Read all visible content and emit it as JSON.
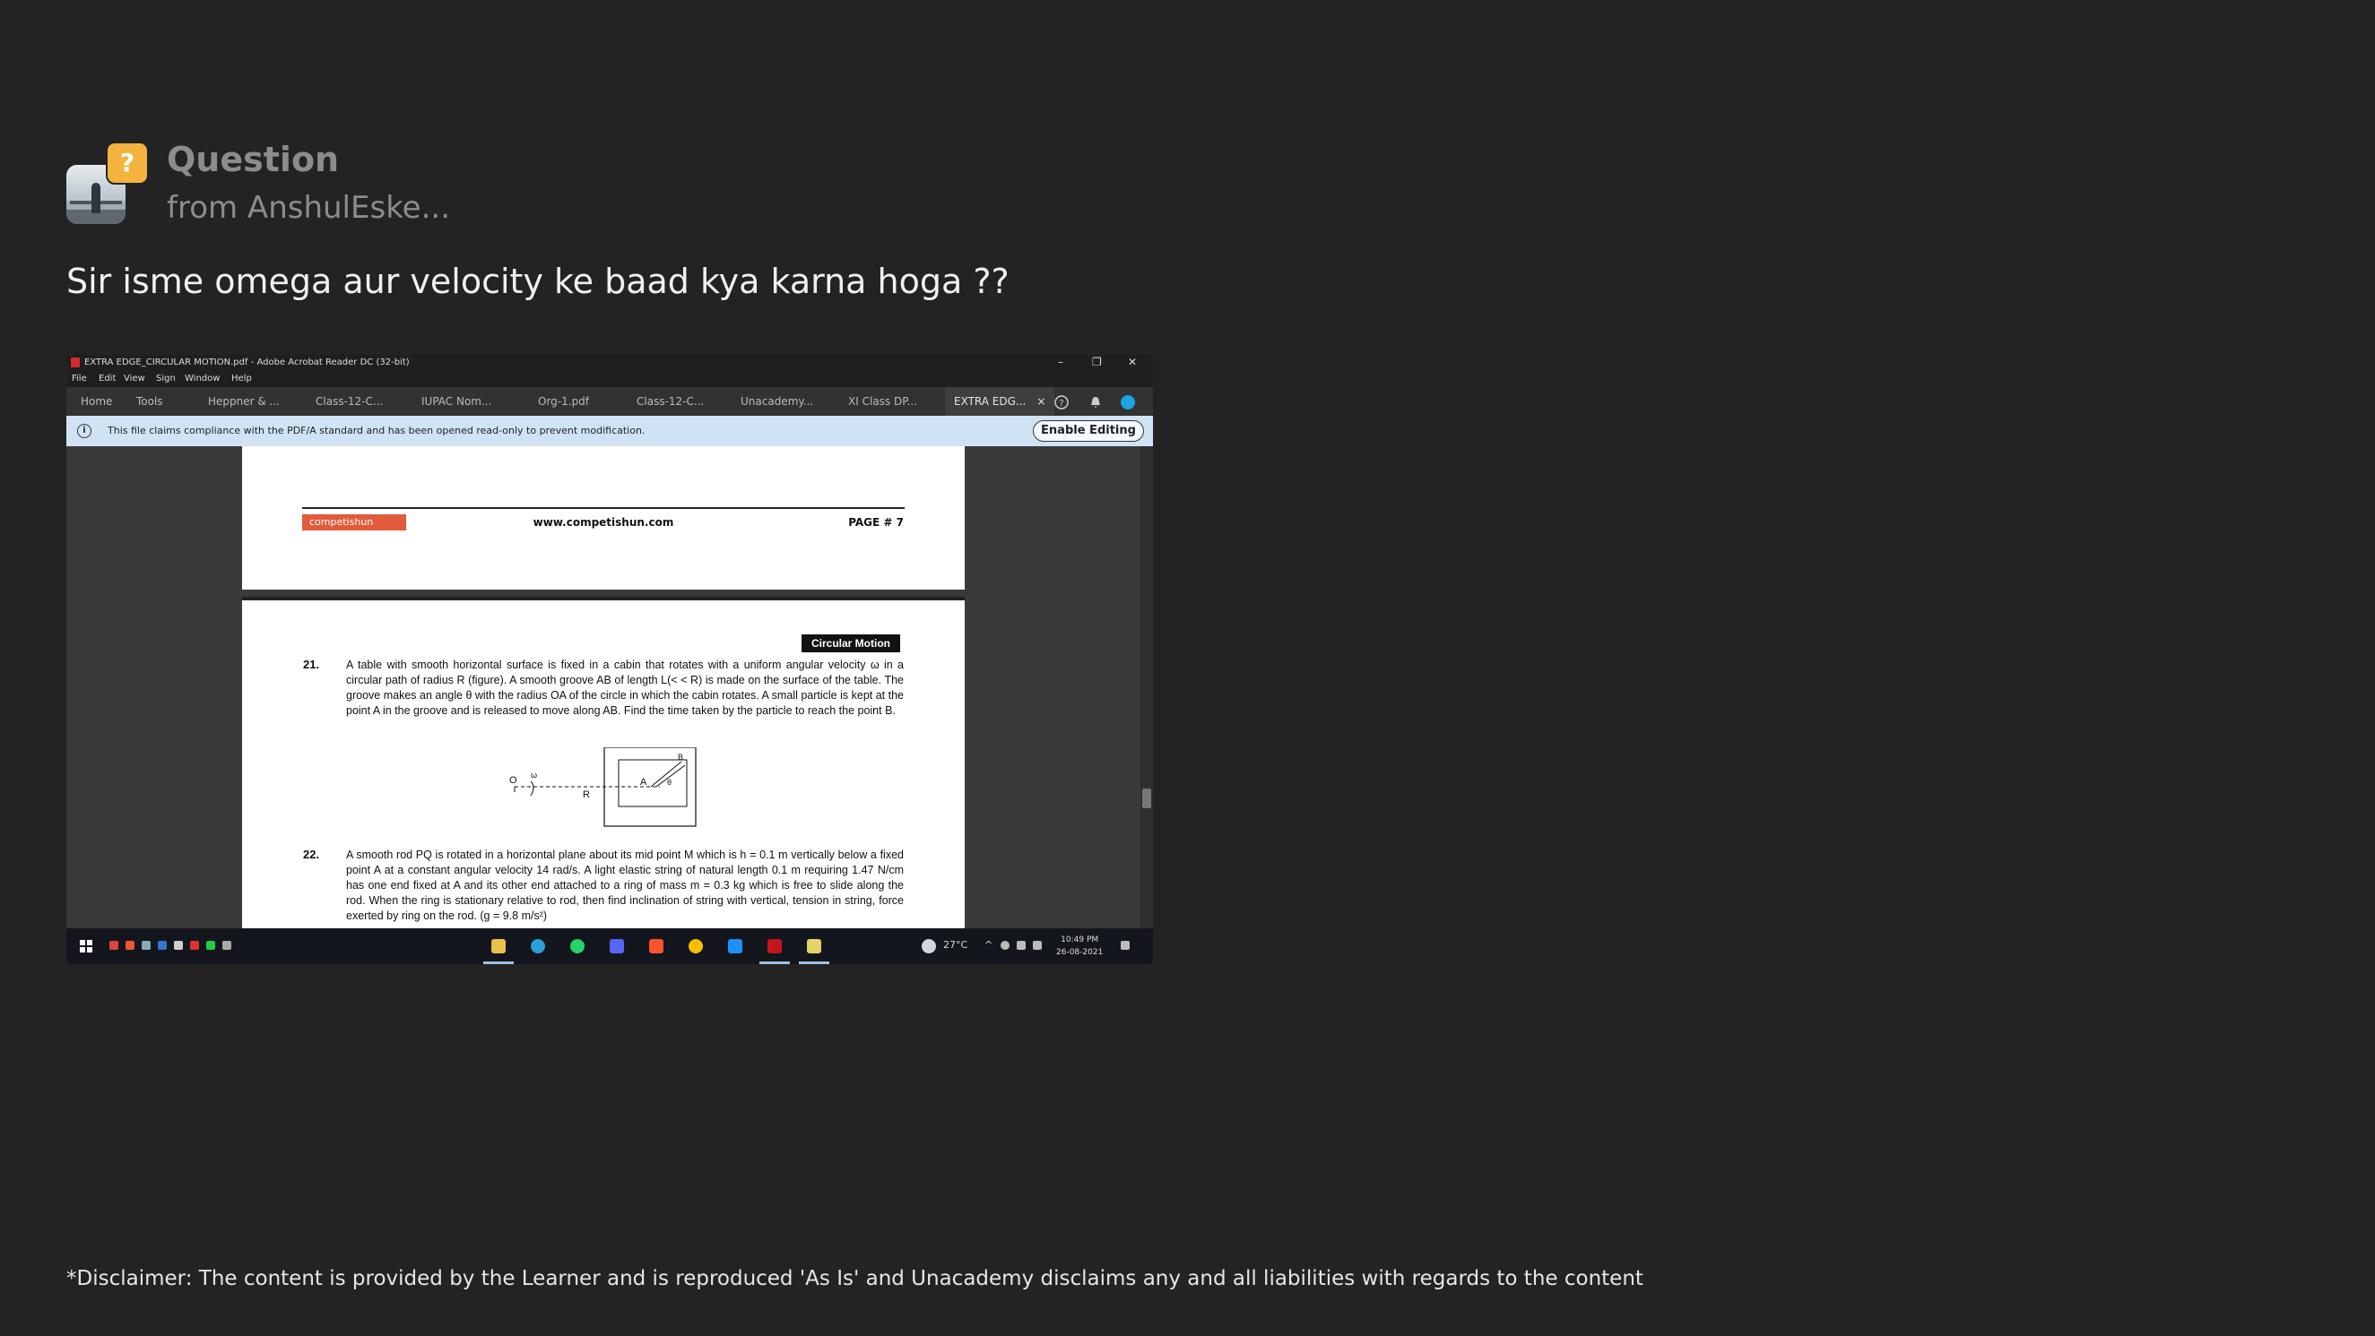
{
  "header": {
    "title": "Question",
    "subtitle": "from AnshulEske...",
    "badge": "?"
  },
  "question_text": "Sir isme omega aur velocity ke baad kya karna hoga ??",
  "screenshot": {
    "window_title": "EXTRA EDGE_CIRCULAR MOTION.pdf - Adobe Acrobat Reader DC (32-bit)",
    "window_controls": {
      "minimize": "–",
      "restore": "❐",
      "close": "✕"
    },
    "menu": [
      "File",
      "Edit",
      "View",
      "Sign",
      "Window",
      "Help"
    ],
    "tabs": [
      "Home",
      "Tools",
      "Heppner & ...",
      "Class-12-C...",
      "IUPAC Nom...",
      "Org-1.pdf",
      "Class-12-C...",
      "Unacademy...",
      "XI Class DP...",
      "EXTRA EDG..."
    ],
    "active_tab_close": "×",
    "info_message": "This file claims compliance with the PDF/A standard and has been opened read-only to prevent modification.",
    "info_icon": "i",
    "enable_editing": "Enable Editing",
    "page1": {
      "logo_text": "competishun",
      "url": "www.competishun.com",
      "page_label": "PAGE # 7"
    },
    "page2": {
      "section_tag": "Circular Motion",
      "q21_num": "21.",
      "q21_text": "A table with smooth horizontal surface is fixed in a cabin that rotates with a uniform angular velocity ω in a circular path of radius R (figure). A smooth groove AB of length L(< < R) is made on the surface of the table. The groove makes an angle θ with the radius OA of the circle in which the cabin rotates. A small particle is kept at the point A in the groove and is released to move along AB. Find the time taken by the particle to reach the point B.",
      "fig_labels": {
        "o": "O",
        "omega": "ω",
        "r": "R",
        "a": "A",
        "b": "B",
        "theta": "θ"
      },
      "q22_num": "22.",
      "q22_text": "A smooth rod PQ is rotated in a horizontal plane about its mid point M which is h = 0.1 m vertically below a fixed point A at a constant angular velocity 14 rad/s. A light elastic string of natural length 0.1 m requiring 1.47 N/cm has one end fixed at A and its other end attached to a ring of mass m = 0.3 kg which is free to slide along the rod. When the ring is stationary relative to rod, then find inclination of string with vertical, tension in string, force exerted by ring on the rod. (g = 9.8 m/s²)"
    },
    "taskbar": {
      "weather": "27°C",
      "time": "10:49 PM",
      "date": "26-08-2021"
    }
  },
  "disclaimer": "*Disclaimer: The content is provided by the Learner and is reproduced 'As Is' and Unacademy disclaims any and all liabilities with regards to the content"
}
